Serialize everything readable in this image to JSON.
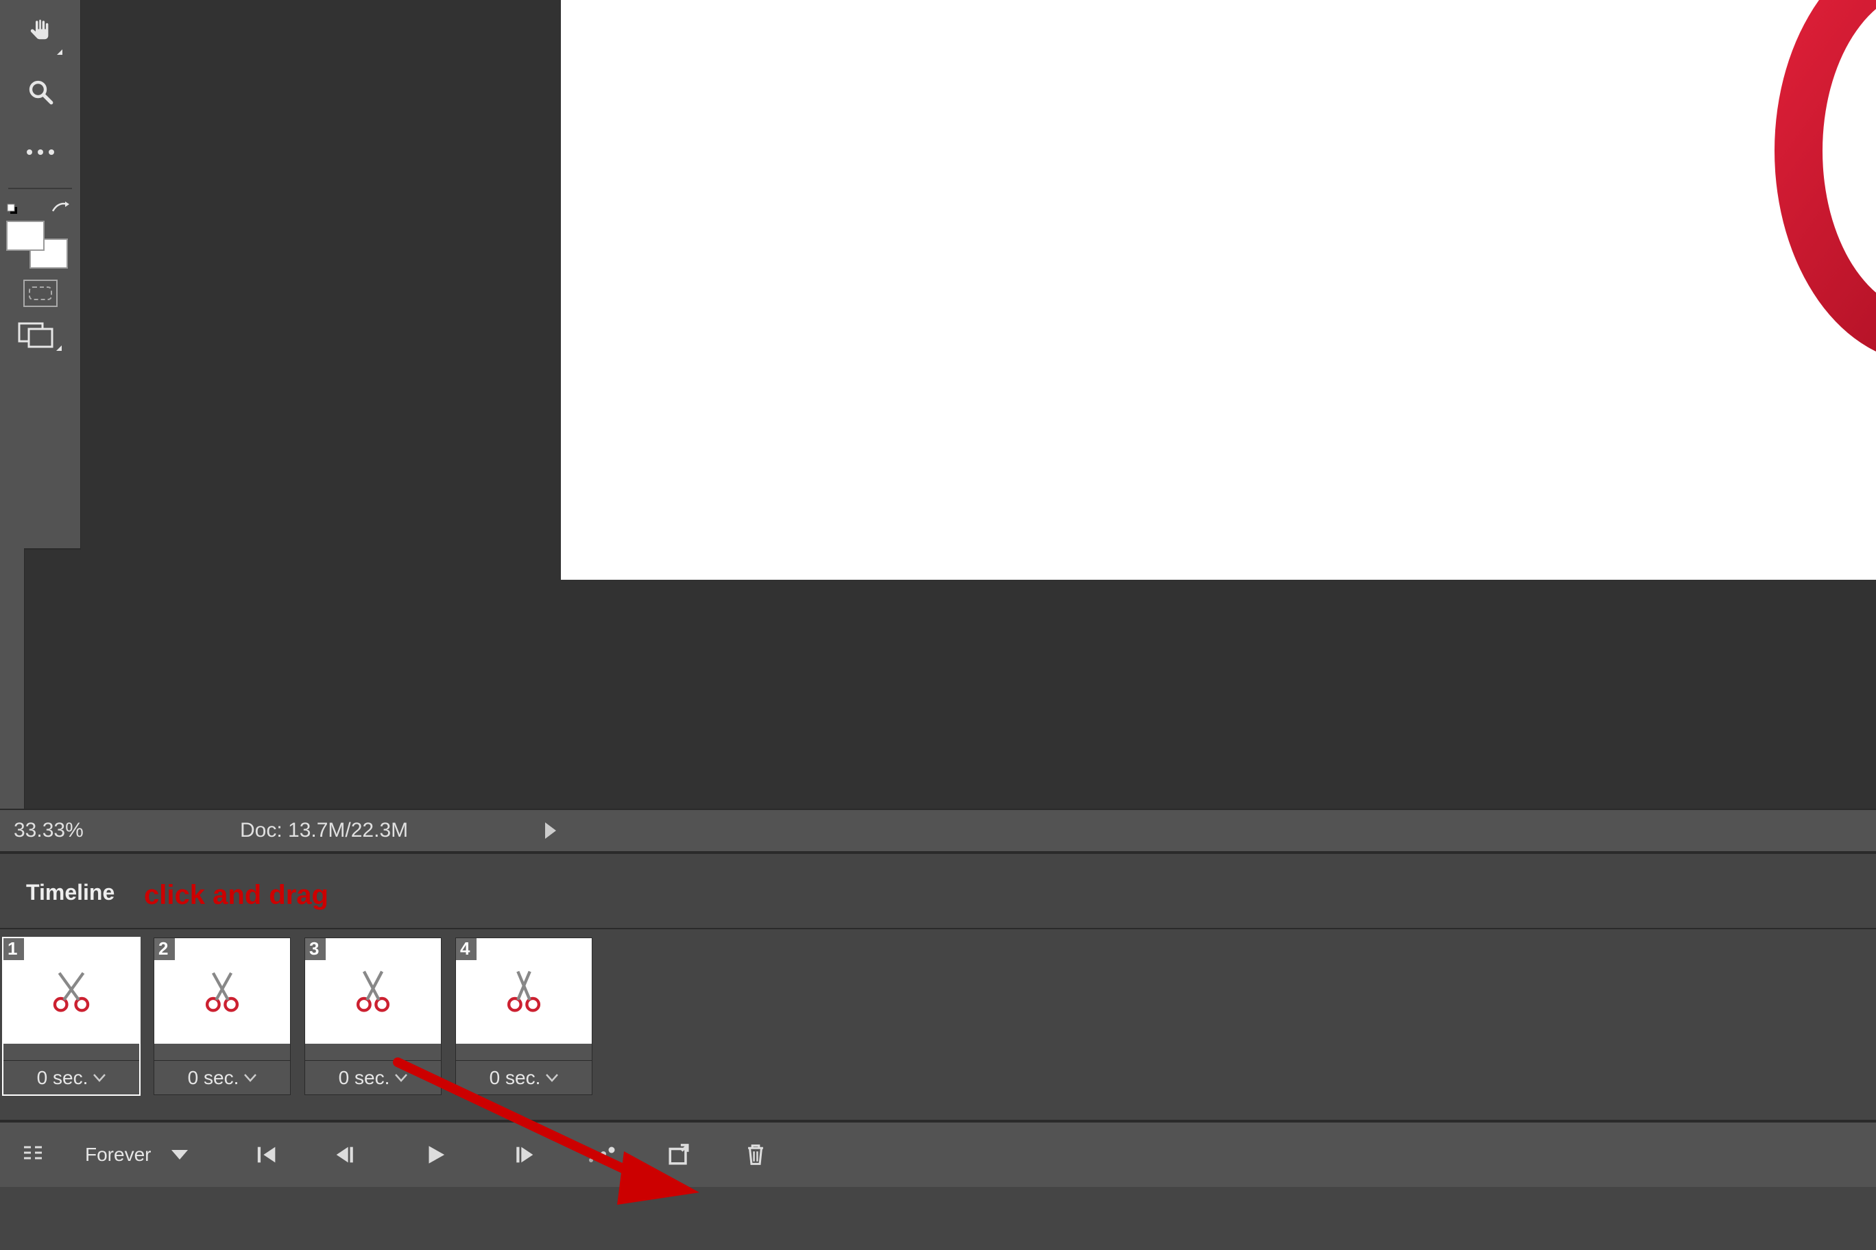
{
  "status": {
    "zoom": "33.33%",
    "doc_label": "Doc: 13.7M/22.3M"
  },
  "timeline": {
    "panel_title": "Timeline",
    "loop_mode": "Forever",
    "annotation": "click and drag",
    "frames": [
      {
        "number": "1",
        "delay": "0 sec.",
        "selected": true
      },
      {
        "number": "2",
        "delay": "0 sec.",
        "selected": false
      },
      {
        "number": "3",
        "delay": "0 sec.",
        "selected": false
      },
      {
        "number": "4",
        "delay": "0 sec.",
        "selected": false
      }
    ]
  },
  "colors": {
    "annotation": "#cc0000"
  }
}
